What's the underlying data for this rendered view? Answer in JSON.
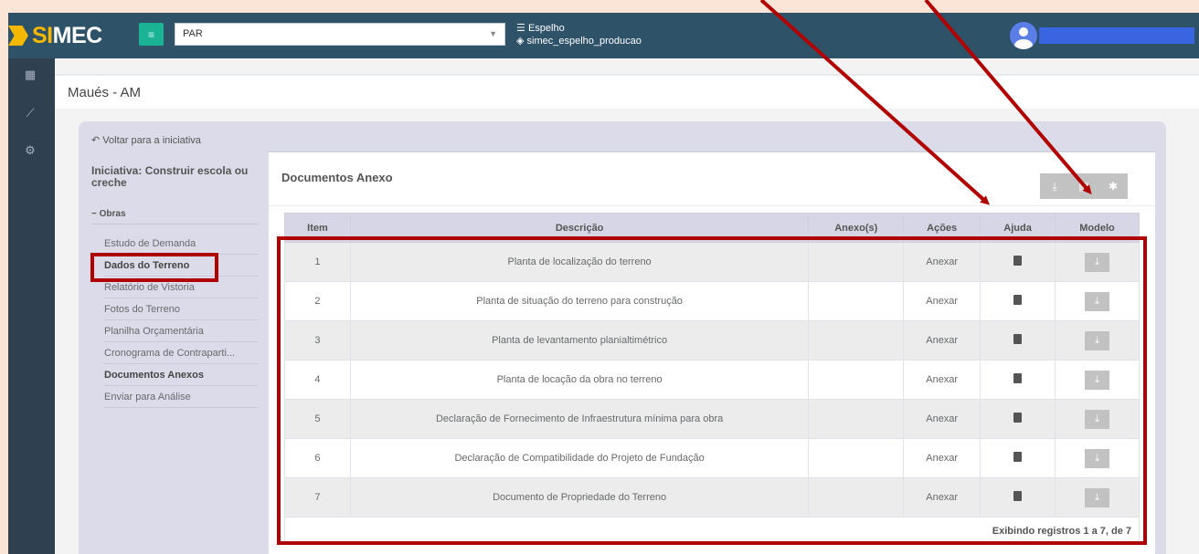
{
  "header": {
    "app_name_prefix": "SI",
    "app_name_suffix": "MEC",
    "system_select": "PAR",
    "env_label": "Espelho",
    "env_db": "simec_espelho_producao"
  },
  "page": {
    "title": "Maués - AM",
    "back_link": "Voltar para a iniciativa",
    "initiative": "Iniciativa: Construir escola ou creche",
    "group": "Obras",
    "nav_items": [
      {
        "label": "Estudo de Demanda",
        "active": false
      },
      {
        "label": "Dados do Terreno",
        "active": true
      },
      {
        "label": "Relatório de Vistoria",
        "active": false
      },
      {
        "label": "Fotos do Terreno",
        "active": false
      },
      {
        "label": "Planilha Orçamentária",
        "active": false
      },
      {
        "label": "Cronograma de Contraparti...",
        "active": false
      },
      {
        "label": "Documentos Anexos",
        "active": true
      },
      {
        "label": "Enviar para Análise",
        "active": false
      }
    ]
  },
  "documents": {
    "title": "Documentos Anexo",
    "columns": [
      "Item",
      "Descrição",
      "Anexo(s)",
      "Ações",
      "Ajuda",
      "Modelo"
    ],
    "rows": [
      {
        "item": "1",
        "desc": "Planta de localização do terreno",
        "anexos": "",
        "acao": "Anexar"
      },
      {
        "item": "2",
        "desc": "Planta de situação do terreno para construção",
        "anexos": "",
        "acao": "Anexar"
      },
      {
        "item": "3",
        "desc": "Planta de levantamento planialtimétrico",
        "anexos": "",
        "acao": "Anexar"
      },
      {
        "item": "4",
        "desc": "Planta de locação da obra no terreno",
        "anexos": "",
        "acao": "Anexar"
      },
      {
        "item": "5",
        "desc": "Declaração de Fornecimento de Infraestrutura mínima para obra",
        "anexos": "",
        "acao": "Anexar"
      },
      {
        "item": "6",
        "desc": "Declaração de Compatibilidade do Projeto de Fundação",
        "anexos": "",
        "acao": "Anexar"
      },
      {
        "item": "7",
        "desc": "Documento de Propriedade do Terreno",
        "anexos": "",
        "acao": "Anexar"
      }
    ],
    "footer": "Exibindo registros 1 a 7, de 7"
  },
  "colors": {
    "annotation": "#b00000",
    "accent": "#1ab394",
    "topbar": "#2e5268"
  },
  "icons": [
    "grid-icon",
    "chart-icon",
    "cogs-icon",
    "back-arrow-icon",
    "download-icon",
    "file-icon",
    "gear-icon",
    "book-icon"
  ]
}
